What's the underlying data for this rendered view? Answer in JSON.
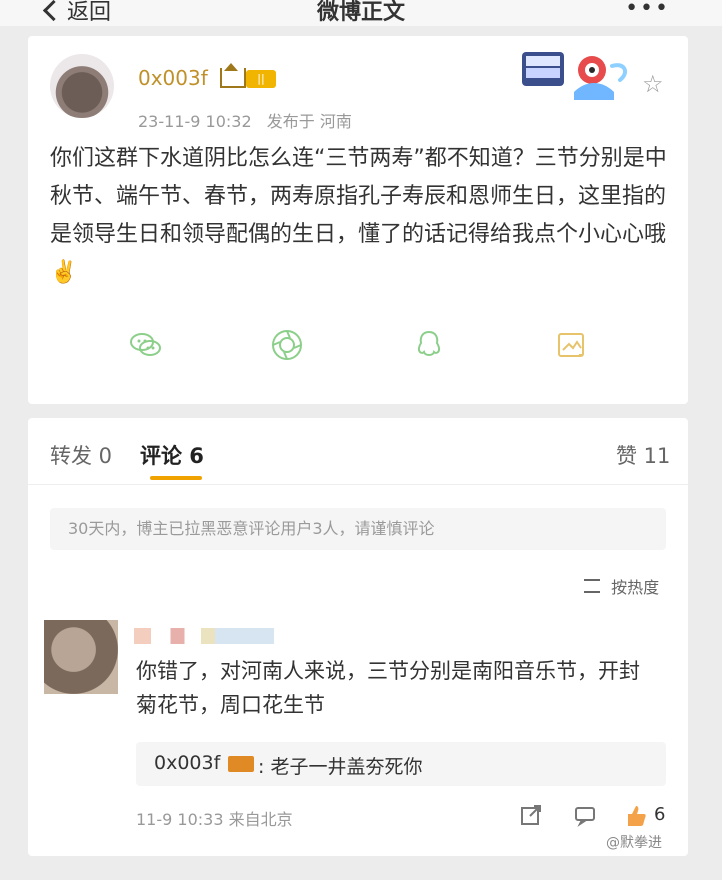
{
  "header": {
    "back_label": "返回",
    "title": "微博正文",
    "more_label": "•••"
  },
  "post": {
    "username": "0x003f",
    "vip_label": "||",
    "date": "23-11-9 10:32",
    "location_text": "发布于 河南",
    "text": "你们这群下水道阴比怎么连“三节两寿”都不知道？三节分别是中秋节、端午节、春节，两寿原指孔子寿辰和恩师生日，这里指的是领导生日和领导配偶的生日，懂了的话记得给我点个小心心哦✌️",
    "share_icons": [
      "wechat-icon",
      "moments-icon",
      "qq-icon",
      "save-image-icon"
    ]
  },
  "comments": {
    "tabs": [
      {
        "label": "转发 0"
      },
      {
        "label": "评论 6"
      },
      {
        "label": "赞 11"
      }
    ],
    "notice": "30天内，博主已拉黑恶意评论用户3人，请谨慎评论",
    "sort_label": "按热度",
    "comment": {
      "text": "你错了，对河南人来说，三节分别是南阳音乐节，开封菊花节，周口花生节",
      "reply_user": "0x003f",
      "reply_text": ": 老子一井盖夯死你",
      "time": "11-9 10:33 来自北京",
      "likes": "6"
    }
  },
  "watermark": "@默拳进"
}
